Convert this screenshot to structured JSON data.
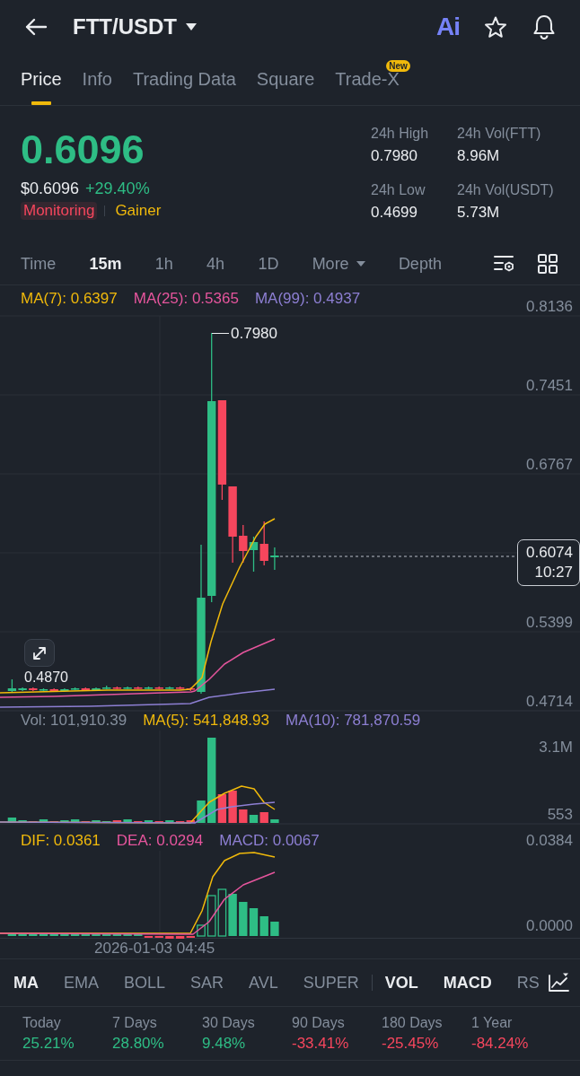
{
  "header": {
    "title": "FTT/USDT",
    "ai_label": "Ai"
  },
  "tabs": [
    {
      "label": "Price",
      "selected": true
    },
    {
      "label": "Info",
      "selected": false
    },
    {
      "label": "Trading Data",
      "selected": false
    },
    {
      "label": "Square",
      "selected": false
    },
    {
      "label": "Trade-X",
      "selected": false,
      "badge": "New"
    }
  ],
  "price": {
    "last": "0.6096",
    "usd": "$0.6096",
    "change": "+29.40%",
    "tags": [
      {
        "label": "Monitoring",
        "color": "#f6465d",
        "highlighted": true
      },
      {
        "label": "Gainer",
        "color": "#f0b90b",
        "highlighted": false
      }
    ]
  },
  "stats": [
    {
      "label": "24h High",
      "value": "0.7980"
    },
    {
      "label": "24h Vol(FTT)",
      "value": "8.96M"
    },
    {
      "label": "24h Low",
      "value": "0.4699"
    },
    {
      "label": "24h Vol(USDT)",
      "value": "5.73M"
    }
  ],
  "intervals": [
    {
      "label": "Time",
      "kind": "option",
      "selected": false
    },
    {
      "label": "15m",
      "kind": "option",
      "selected": true
    },
    {
      "label": "1h",
      "kind": "option",
      "selected": false
    },
    {
      "label": "4h",
      "kind": "option",
      "selected": false
    },
    {
      "label": "1D",
      "kind": "option",
      "selected": false
    },
    {
      "label": "More",
      "kind": "menu",
      "selected": false
    },
    {
      "label": "Depth",
      "kind": "option",
      "selected": false
    }
  ],
  "chart": {
    "price_legend": [
      {
        "label": "MA(7): 0.6397",
        "color": "#f0b90b"
      },
      {
        "label": "MA(25): 0.5365",
        "color": "#e6559d"
      },
      {
        "label": "MA(99): 0.4937",
        "color": "#8d7fd3"
      }
    ],
    "price_axis": [
      "0.8136",
      "0.7451",
      "0.6767",
      "0.5399",
      "0.4714"
    ],
    "high_label": "0.7980",
    "low_label": "0.4870",
    "last_price": "0.6074",
    "countdown": "10:27",
    "volume_legend": [
      {
        "label": "Vol: 101,910.39",
        "color": "#848e9c"
      },
      {
        "label": "MA(5): 541,848.93",
        "color": "#f0b90b"
      },
      {
        "label": "MA(10): 781,870.59",
        "color": "#8d7fd3"
      }
    ],
    "volume_axis": [
      "3.1M",
      "553"
    ],
    "macd_legend": [
      {
        "label": "DIF: 0.0361",
        "color": "#f0b90b"
      },
      {
        "label": "DEA: 0.0294",
        "color": "#e6559d"
      },
      {
        "label": "MACD: 0.0067",
        "color": "#8d7fd3"
      }
    ],
    "macd_axis": [
      "0.0384",
      "0.0000"
    ],
    "time_label": "2026-01-03 04:45"
  },
  "indicators": {
    "main": [
      {
        "label": "MA",
        "selected": true
      },
      {
        "label": "EMA",
        "selected": false
      },
      {
        "label": "BOLL",
        "selected": false
      },
      {
        "label": "SAR",
        "selected": false
      },
      {
        "label": "AVL",
        "selected": false
      },
      {
        "label": "SUPER",
        "selected": false
      }
    ],
    "sub": [
      {
        "label": "VOL",
        "selected": true
      },
      {
        "label": "MACD",
        "selected": true
      },
      {
        "label": "RS",
        "selected": false
      }
    ]
  },
  "returns": [
    {
      "label": "Today",
      "value": "25.21%",
      "color": "#2ebd85"
    },
    {
      "label": "7 Days",
      "value": "28.80%",
      "color": "#2ebd85"
    },
    {
      "label": "30 Days",
      "value": "9.48%",
      "color": "#2ebd85"
    },
    {
      "label": "90 Days",
      "value": "-33.41%",
      "color": "#f6465d"
    },
    {
      "label": "180 Days",
      "value": "-25.45%",
      "color": "#f6465d"
    },
    {
      "label": "1 Year",
      "value": "-84.24%",
      "color": "#f6465d"
    }
  ]
}
